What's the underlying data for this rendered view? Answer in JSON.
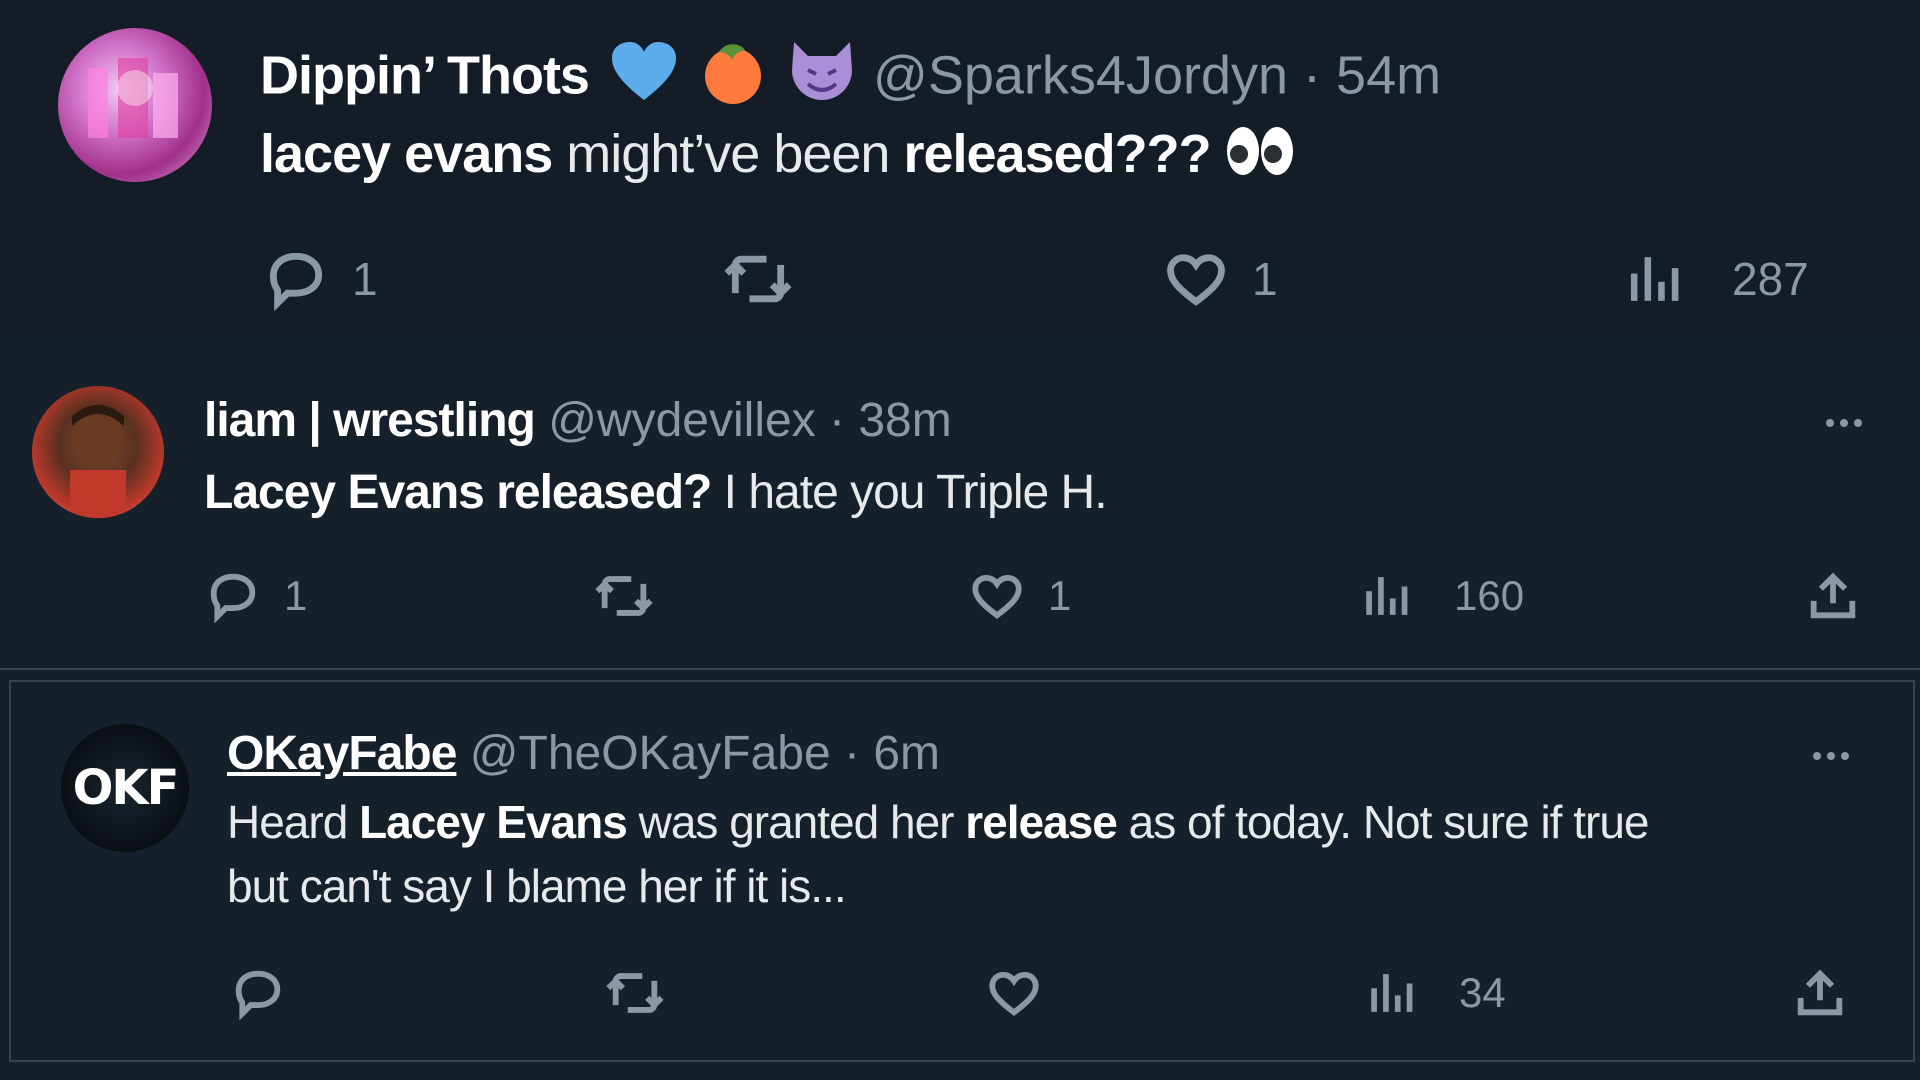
{
  "tweets": [
    {
      "name": "Dippin’ Thots",
      "handle": "@Sparks4Jordyn",
      "separator": "·",
      "time": "54m",
      "text_parts": [
        "lacey evans",
        " might’ve been ",
        "released???"
      ],
      "text_emoji": "👀",
      "name_emoji": [
        "blue-heart",
        "peach",
        "smiling-imp"
      ],
      "replies": "1",
      "retweets": "",
      "likes": "1",
      "views": "287"
    },
    {
      "name": "liam | wrestling",
      "handle": "@wydevillex",
      "separator": "·",
      "time": "38m",
      "text_parts": [
        "Lacey Evans released?",
        " I hate you Triple H."
      ],
      "replies": "1",
      "retweets": "",
      "likes": "1",
      "views": "160"
    },
    {
      "name": "OKayFabe",
      "handle": "@TheOKayFabe",
      "separator": "·",
      "time": "6m",
      "avatar_text": "OKF",
      "text_parts": [
        "Heard ",
        "Lacey Evans",
        " was granted her ",
        "release",
        " as of today. Not sure if true",
        "but can't say I blame her if it is..."
      ],
      "replies": "",
      "retweets": "",
      "likes": "",
      "views": "34"
    }
  ],
  "colors": {
    "background": "#15202b",
    "muted": "#8b98a5",
    "border": "#38444d",
    "text": "#e7e9ea"
  }
}
